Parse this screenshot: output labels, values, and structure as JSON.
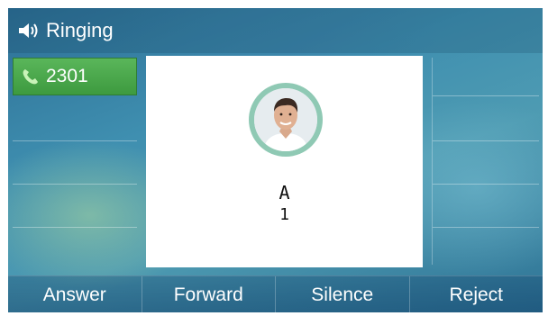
{
  "status": {
    "title": "Ringing",
    "icon": "speaker-icon"
  },
  "line": {
    "label": "2301",
    "icon": "phone-icon",
    "color": "#4aa84c"
  },
  "caller": {
    "name": "A",
    "number": "1"
  },
  "softkeys": [
    {
      "label": "Answer"
    },
    {
      "label": "Forward"
    },
    {
      "label": "Silence"
    },
    {
      "label": "Reject"
    }
  ]
}
